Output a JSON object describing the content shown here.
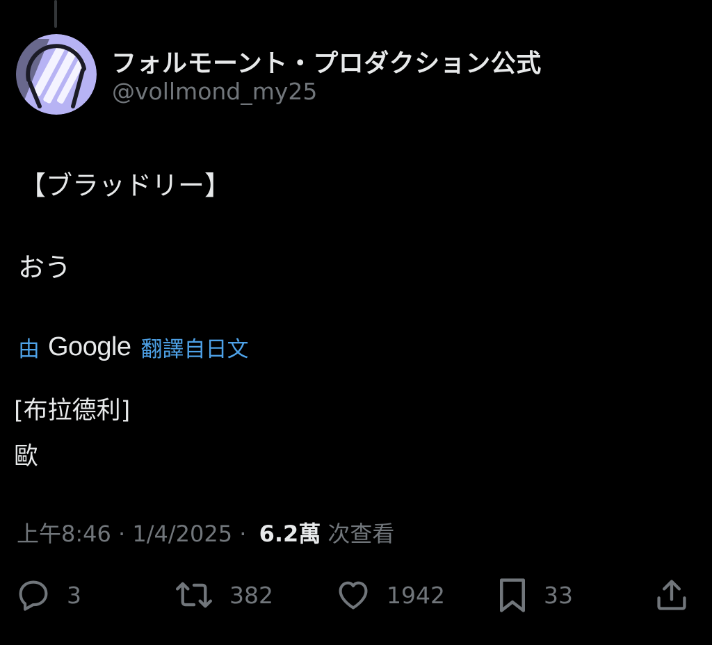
{
  "author": {
    "display_name": "フォルモーント・プロダクション公式",
    "handle": "@vollmond_my25",
    "avatar_icon": "vollmond-logo-avatar"
  },
  "tweet": {
    "lines": [
      "【ブラッドリー】",
      "おう"
    ]
  },
  "translation": {
    "by_label": "由",
    "provider": "Google",
    "from_label": "翻譯自日文",
    "lines": [
      "[布拉德利]",
      "歐"
    ]
  },
  "meta": {
    "time": "上午8:46",
    "separator1": " · ",
    "date": "1/4/2025",
    "separator2": " · ",
    "views_count": "6.2萬",
    "views_label": "次查看"
  },
  "actions": {
    "reply": {
      "icon": "reply-icon",
      "count": "3"
    },
    "retweet": {
      "icon": "retweet-icon",
      "count": "382"
    },
    "like": {
      "icon": "heart-icon",
      "count": "1942"
    },
    "bookmark": {
      "icon": "bookmark-icon",
      "count": "33"
    },
    "share": {
      "icon": "share-icon"
    }
  },
  "colors": {
    "background": "#000000",
    "primary_text": "#e7e9ea",
    "secondary_text": "#71767b",
    "link_blue": "#4ea2e8",
    "avatar_lavender": "#b7b3f4"
  }
}
